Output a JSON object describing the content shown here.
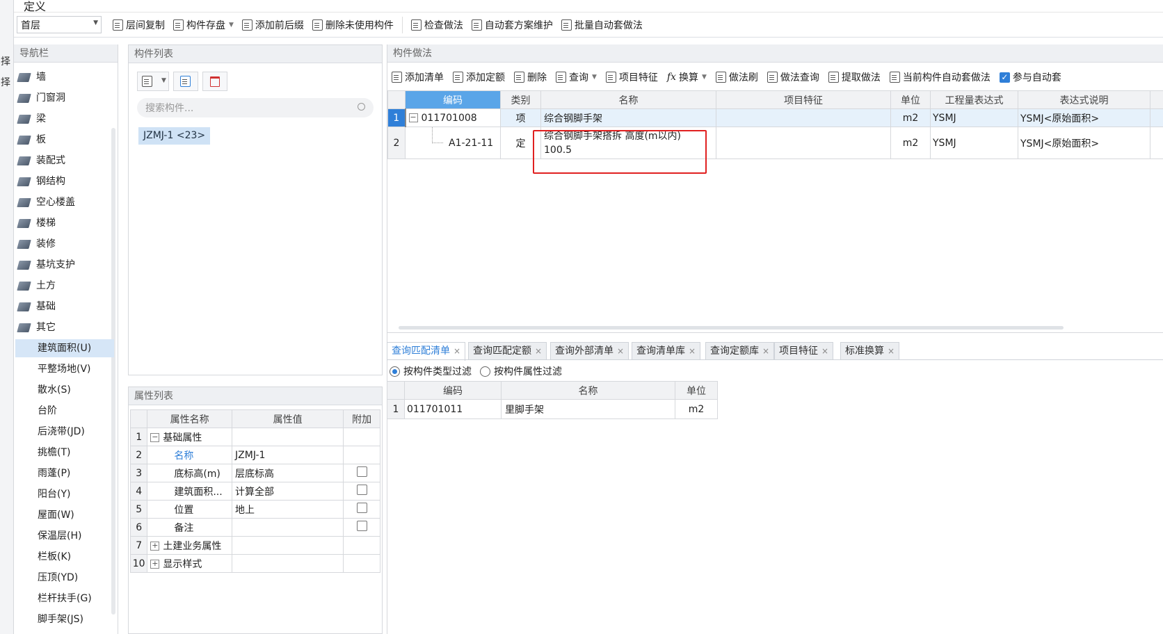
{
  "window": {
    "title": "定义",
    "side_labels": [
      "择",
      "择"
    ]
  },
  "toolbar": {
    "floor_value": "首层",
    "items": [
      "层间复制",
      "构件存盘",
      "添加前后缀",
      "删除未使用构件",
      "检查做法",
      "自动套方案维护",
      "批量自动套做法"
    ]
  },
  "nav": {
    "title": "导航栏",
    "items": [
      "墙",
      "门窗洞",
      "梁",
      "板",
      "装配式",
      "钢结构",
      "空心楼盖",
      "楼梯",
      "装修",
      "基坑支护",
      "土方",
      "基础",
      "其它"
    ],
    "sub_items": [
      "建筑面积(U)",
      "平整场地(V)",
      "散水(S)",
      "台阶",
      "后浇带(JD)",
      "挑檐(T)",
      "雨蓬(P)",
      "阳台(Y)",
      "屋面(W)",
      "保温层(H)",
      "栏板(K)",
      "压顶(YD)",
      "栏杆扶手(G)",
      "脚手架(JS)"
    ],
    "selected": "建筑面积(U)"
  },
  "component_list": {
    "title": "构件列表",
    "search_placeholder": "搜索构件...",
    "selected_item": "JZMJ-1 <23>"
  },
  "properties": {
    "title": "属性列表",
    "headers": [
      "属性名称",
      "属性值",
      "附加"
    ],
    "rows": [
      {
        "num": "1",
        "name": "基础属性",
        "value": "",
        "toggle": "−"
      },
      {
        "num": "2",
        "name": "名称",
        "value": "JZMJ-1"
      },
      {
        "num": "3",
        "name": "底标高(m)",
        "value": "层底标高",
        "check": true
      },
      {
        "num": "4",
        "name": "建筑面积...",
        "value": "计算全部",
        "check": true
      },
      {
        "num": "5",
        "name": "位置",
        "value": "地上",
        "check": true
      },
      {
        "num": "6",
        "name": "备注",
        "value": "",
        "check": true
      },
      {
        "num": "7",
        "name": "土建业务属性",
        "value": "",
        "toggle": "+"
      },
      {
        "num": "10",
        "name": "显示样式",
        "value": "",
        "toggle": "+"
      }
    ]
  },
  "method": {
    "title": "构件做法",
    "toolbar": [
      "添加清单",
      "添加定额",
      "删除",
      "查询",
      "项目特征",
      "换算",
      "做法刷",
      "做法查询",
      "提取做法",
      "当前构件自动套做法",
      "参与自动套"
    ],
    "headers": [
      "编码",
      "类别",
      "名称",
      "项目特征",
      "单位",
      "工程量表达式",
      "表达式说明"
    ],
    "rows": [
      {
        "num": "1",
        "code": "011701008",
        "type": "项",
        "name": "综合钢脚手架",
        "feature": "",
        "unit": "m2",
        "expr": "YSMJ",
        "desc": "YSMJ<原始面积>"
      },
      {
        "num": "2",
        "code": "A1-21-11",
        "type": "定",
        "name": "综合钢脚手架搭拆 高度(m以内)",
        "name2": "100.5",
        "feature": "",
        "unit": "m2",
        "expr": "YSMJ",
        "desc": "YSMJ<原始面积>"
      }
    ]
  },
  "query": {
    "tabs": [
      "查询匹配清单",
      "查询匹配定额",
      "查询外部清单",
      "查询清单库",
      "查询定额库",
      "项目特征",
      "标准换算"
    ],
    "filters": [
      "按构件类型过滤",
      "按构件属性过滤"
    ],
    "headers": [
      "编码",
      "名称",
      "单位"
    ],
    "rows": [
      {
        "num": "1",
        "code": "011701011",
        "name": "里脚手架",
        "unit": "m2"
      }
    ]
  },
  "colors": {
    "accent": "#2f7fd8",
    "highlight_border": "#e02020",
    "selected_nav": "#d6e6f7"
  }
}
